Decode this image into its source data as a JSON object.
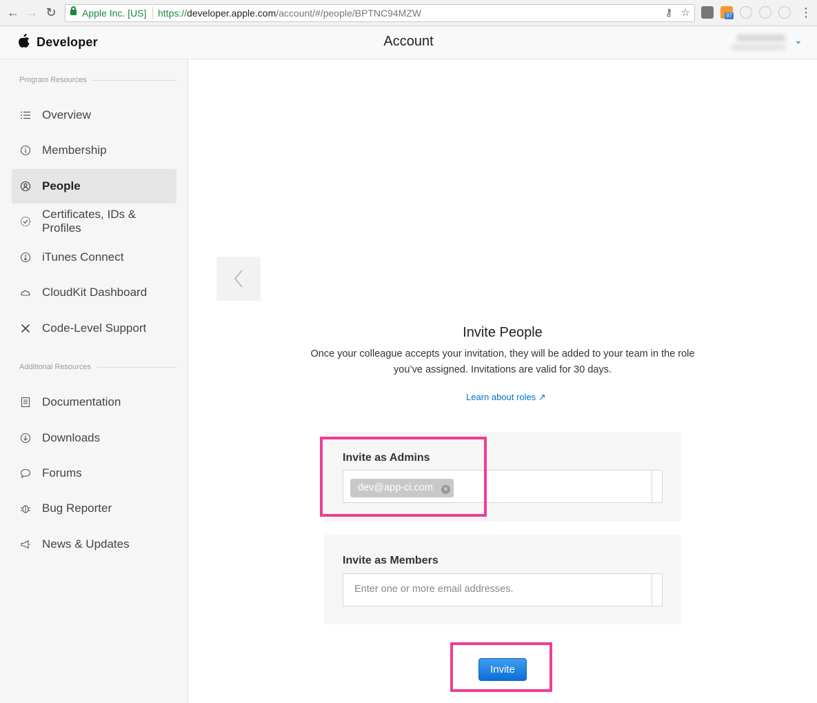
{
  "browser": {
    "secure_label": "Apple Inc. [US]",
    "url_scheme": "https://",
    "url_host": "developer.apple.com",
    "url_path": "/account/#/people/BPTNC94MZW",
    "extension_badge": "97"
  },
  "header": {
    "brand": "Developer",
    "title": "Account"
  },
  "sidebar": {
    "program_heading": "Program Resources",
    "program_items": [
      {
        "label": "Overview",
        "icon": "list-icon",
        "active": false
      },
      {
        "label": "Membership",
        "icon": "info-icon",
        "active": false
      },
      {
        "label": "People",
        "icon": "people-icon",
        "active": true
      },
      {
        "label": "Certificates, IDs & Profiles",
        "icon": "certificate-icon",
        "active": false
      },
      {
        "label": "iTunes Connect",
        "icon": "itunes-icon",
        "active": false
      },
      {
        "label": "CloudKit Dashboard",
        "icon": "cloud-icon",
        "active": false
      },
      {
        "label": "Code-Level Support",
        "icon": "tools-icon",
        "active": false
      }
    ],
    "additional_heading": "Additional Resources",
    "additional_items": [
      {
        "label": "Documentation",
        "icon": "document-icon"
      },
      {
        "label": "Downloads",
        "icon": "download-icon"
      },
      {
        "label": "Forums",
        "icon": "speech-bubble-icon"
      },
      {
        "label": "Bug Reporter",
        "icon": "bug-icon"
      },
      {
        "label": "News & Updates",
        "icon": "megaphone-icon"
      }
    ]
  },
  "invite": {
    "title": "Invite People",
    "description": "Once your colleague accepts your invitation, they will be added to your team in the role you’ve assigned. Invitations are valid for 30 days.",
    "learn_link": "Learn about roles ↗",
    "admins_label": "Invite as Admins",
    "admin_emails": [
      "dev@app-ci.com"
    ],
    "members_label": "Invite as Members",
    "members_placeholder": "Enter one or more email addresses.",
    "button_label": "Invite"
  },
  "colors": {
    "accent": "#0070c9",
    "highlight": "#ef3d94",
    "secure_green": "#1a8a3a"
  }
}
